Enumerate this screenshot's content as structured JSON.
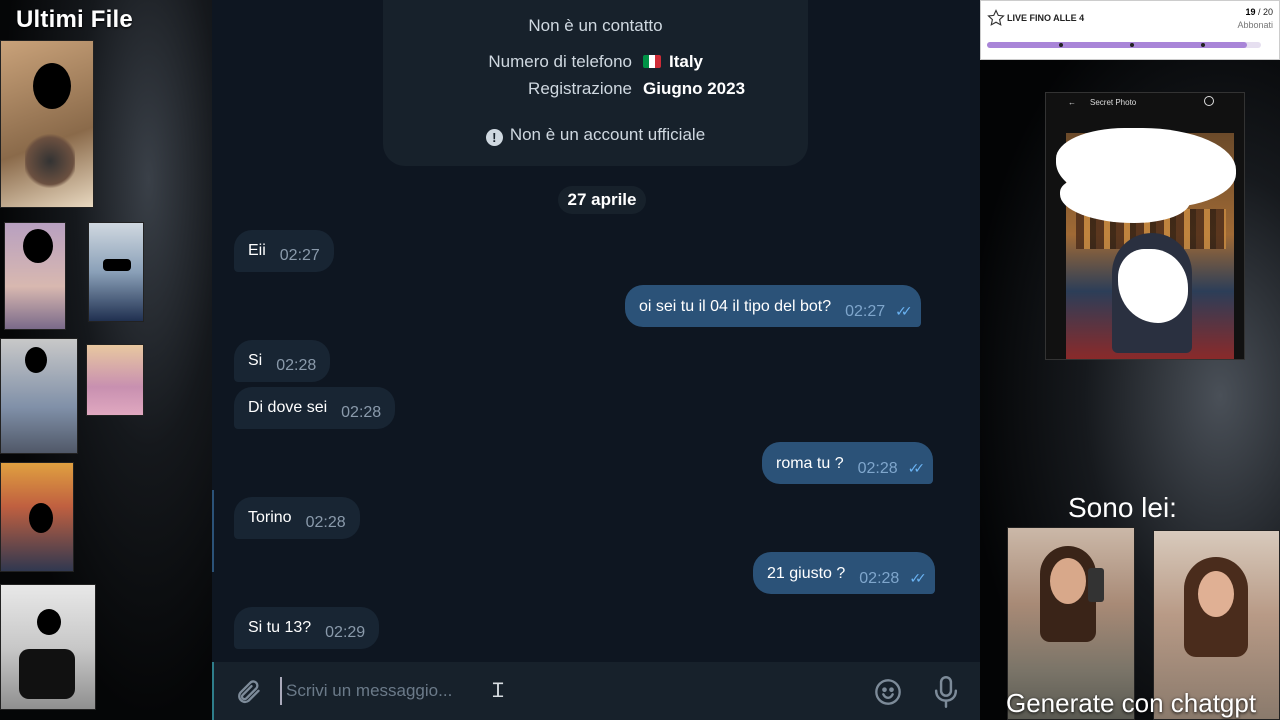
{
  "left_panel": {
    "title": "Ultimi File",
    "thumbnails": [
      "photo-thumbnail",
      "photo-thumbnail",
      "photo-thumbnail",
      "photo-thumbnail",
      "photo-thumbnail",
      "photo-thumbnail",
      "photo-thumbnail"
    ]
  },
  "info_card": {
    "top_text": "Non è un contatto",
    "phone_label": "Numero di telefono",
    "phone_value": "Italy",
    "registration_label": "Registrazione",
    "registration_value": "Giugno 2023",
    "warning_text": "Non è un account ufficiale"
  },
  "date_separator": "27 aprile",
  "messages": [
    {
      "direction": "in",
      "text": "Eii",
      "time": "02:27"
    },
    {
      "direction": "out",
      "text": "oi sei tu il 04 il tipo del bot?",
      "time": "02:27",
      "read": true
    },
    {
      "direction": "in",
      "text": "Si",
      "time": "02:28"
    },
    {
      "direction": "in",
      "text": "Di dove sei",
      "time": "02:28"
    },
    {
      "direction": "out",
      "text": "roma tu ?",
      "time": "02:28",
      "read": true
    },
    {
      "direction": "in",
      "text": "Torino",
      "time": "02:28"
    },
    {
      "direction": "out",
      "text": "21 giusto ?",
      "time": "02:28",
      "read": true
    },
    {
      "direction": "in",
      "text": "Si tu 13?",
      "time": "02:29"
    }
  ],
  "composer": {
    "placeholder": "Scrivi un messaggio..."
  },
  "live_widget": {
    "label": "LIVE FINO ALLE 4",
    "count_current": "19",
    "count_total": "/ 20",
    "sub": "Abbonati",
    "progress": 0.95
  },
  "phone_screenshot": {
    "title": "Secret Photo"
  },
  "right_caption_top": "Sono lei:",
  "right_caption_bottom": "Generate con chatgpt",
  "colors": {
    "chat_bg": "#0e1621",
    "bubble_in": "#182533",
    "bubble_out": "#2b5278",
    "read_ticks": "#6ab3f3",
    "progress_fill": "#a985d8"
  }
}
